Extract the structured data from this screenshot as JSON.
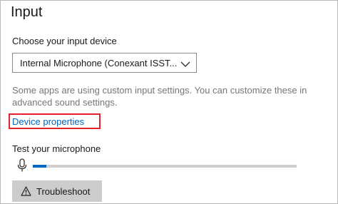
{
  "section": {
    "title": "Input"
  },
  "device": {
    "label": "Choose your input device",
    "selected": "Internal Microphone (Conexant ISST..."
  },
  "hint": {
    "text": "Some apps are using custom input settings. You can customize these in advanced sound settings."
  },
  "device_properties_link": "Device properties",
  "test": {
    "label": "Test your microphone",
    "level": 0.05
  },
  "troubleshoot_button": "Troubleshoot",
  "colors": {
    "accent": "#0067c0",
    "highlight_box": "#e2232b",
    "hint_text": "#767676"
  }
}
